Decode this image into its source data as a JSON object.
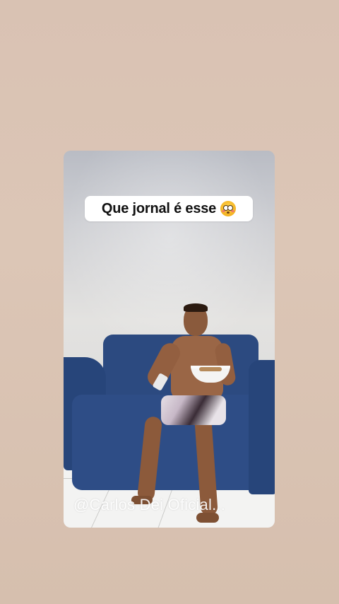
{
  "story": {
    "caption": "Que jornal é esse",
    "caption_emoji": "flushed-emoji-icon",
    "watermark": "@Carlos Dei Oficial..."
  },
  "colors": {
    "background": "#dcc6b6",
    "sticker_bg": "#ffffff",
    "caption_text": "#111111",
    "sofa": "#2e4d86"
  }
}
